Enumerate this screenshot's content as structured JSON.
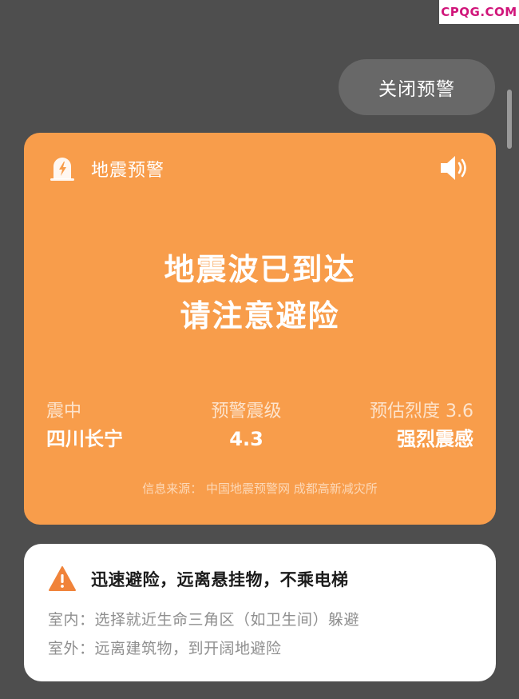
{
  "watermark": "CPQG.COM",
  "close_button_label": "关闭预警",
  "alert": {
    "title": "地震预警",
    "headline_line1": "地震波已到达",
    "headline_line2": "请注意避险",
    "epicenter_label": "震中",
    "epicenter_value": "四川长宁",
    "magnitude_label": "预警震级",
    "magnitude_value": "4.3",
    "intensity_label": "预估烈度 3.6",
    "intensity_value": "强烈震感",
    "source": "信息来源：  中国地震预警网 成都高新减灾所",
    "header_icon": "earthquake-warning-icon",
    "sound_icon": "speaker-icon",
    "accent_color": "#f89d4b"
  },
  "tips": {
    "title": "迅速避险，远离悬挂物，不乘电梯",
    "indoor": "室内：选择就近生命三角区（如卫生间）躲避",
    "outdoor": "室外：远离建筑物，到开阔地避险",
    "icon": "warning-triangle-icon",
    "icon_color": "#f0833a"
  }
}
